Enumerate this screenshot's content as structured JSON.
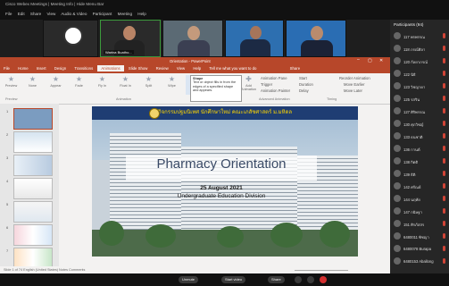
{
  "webex": {
    "title": "Cisco Webex Meetings  |  Meeting Info  |  Hide Menu Bar",
    "menu": [
      "File",
      "Edit",
      "Share",
      "View",
      "Audio & Video",
      "Participant",
      "Meeting",
      "Help"
    ]
  },
  "videos": [
    {
      "name": ""
    },
    {
      "name": "Warina Buatho..."
    },
    {
      "name": ""
    },
    {
      "name": ""
    },
    {
      "name": ""
    }
  ],
  "powerpoint": {
    "title": "Orientation - PowerPoint",
    "tabs": [
      "File",
      "Home",
      "Insert",
      "Design",
      "Transitions",
      "Animations",
      "Slide Show",
      "Review",
      "View",
      "Help",
      "Tell me what you want to do",
      "Share"
    ],
    "active_tab": "Animations",
    "ribbon_buttons": [
      "Preview",
      "None",
      "Appear",
      "Fade",
      "Fly In",
      "Float In",
      "Split",
      "Wipe",
      "Shape",
      "Wheel",
      "Random Bars",
      "Grow & Turn",
      "Effect Options",
      "Add Animation",
      "Animation Pane",
      "Trigger",
      "Animation Painter",
      "Start",
      "Duration",
      "Delay",
      "Reorder Animation",
      "Move Earlier",
      "Move Later"
    ],
    "groups": [
      "Preview",
      "Animation",
      "Advanced Animation",
      "Timing"
    ],
    "tooltip": {
      "title": "Shape",
      "body": "Text or object fills in from the edges of a specified shape and appears."
    },
    "slide": {
      "header": "กิจกรรมปฐมนิเทศ นักศึกษาใหม่ คณะเภสัชศาสตร์ ม.มหิดล",
      "title": "Pharmacy Orientation",
      "date": "25 August 2021",
      "division": "Undergraduate Education Division"
    },
    "notes_placeholder": "Click to add notes",
    "status": "Slide 1 of 74   English (United States)   Notes   Comments"
  },
  "participants": {
    "header": "Participants (94)",
    "list": [
      "117 พรพรรณ",
      "118 ภรณ์ศิลา",
      "120 กัลยาภรณ์",
      "122 นิธิ",
      "123 วิชญาดา",
      "125 รสริน",
      "127 ศิริพรรณ",
      "130 ศุภวิชญ์",
      "133 ธนชาติ",
      "136 กานต์",
      "138 กิตติ",
      "139 ธิติ",
      "142 ศรัณย์",
      "144 นฤทัย",
      "147 กนิษฐา",
      "151 ศิรภัสสร",
      "6480011 พิชญา",
      "6480078 Burapa",
      "6480153 Aballong"
    ]
  },
  "bottom_bar": {
    "unmute": "Unmute",
    "start_video": "Start video",
    "share": "Share",
    "more": "...",
    "end": "×"
  }
}
